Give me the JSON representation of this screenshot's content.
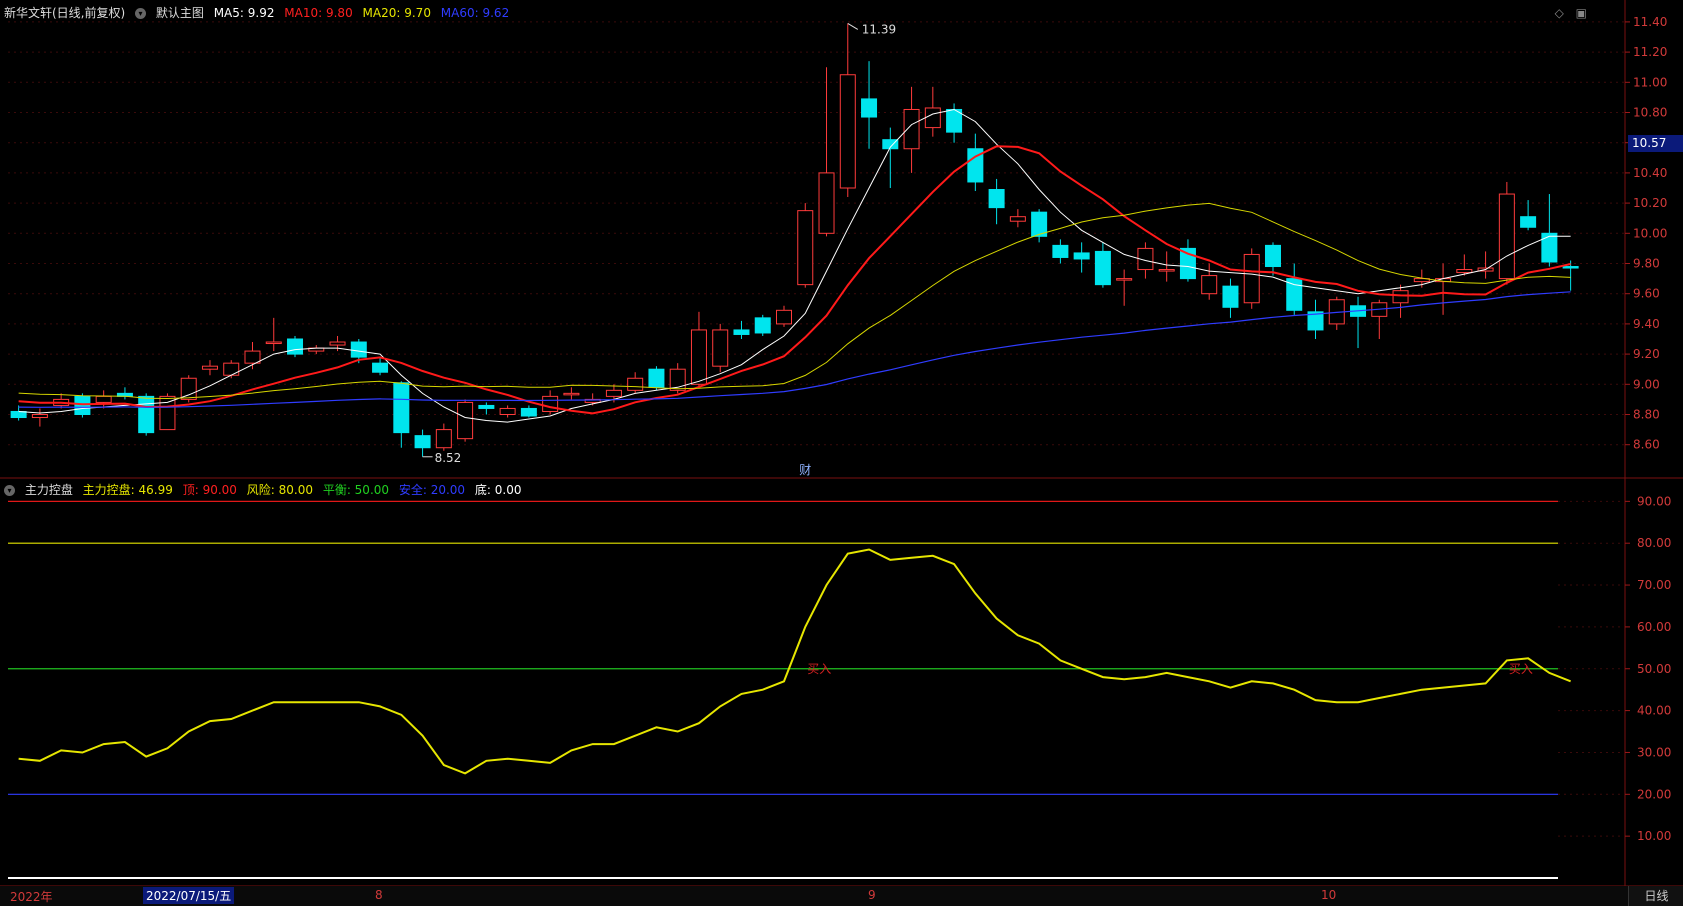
{
  "main_panel": {
    "title": "新华文轩(日线,前复权)",
    "template": "默认主图",
    "ma": [
      {
        "label": "MA5: 9.92",
        "color": "#ffffff"
      },
      {
        "label": "MA10: 9.80",
        "color": "#ff2020"
      },
      {
        "label": "MA20: 9.70",
        "color": "#e6e600"
      },
      {
        "label": "MA60: 9.62",
        "color": "#2f3cff"
      }
    ],
    "high_mark": "11.39",
    "low_mark": "8.52",
    "event_mark": "财",
    "current_price": "10.57",
    "yaxis": [
      "11.40",
      "11.20",
      "11.00",
      "10.80",
      "10.60",
      "10.40",
      "10.20",
      "10.00",
      "9.80",
      "9.60",
      "9.40",
      "9.20",
      "9.00",
      "8.80",
      "8.60"
    ]
  },
  "sub_panel": {
    "name": "主力控盘",
    "items": [
      {
        "label": "主力控盘: 46.99",
        "color": "#e6e600"
      },
      {
        "label": "顶: 90.00",
        "color": "#ff2020"
      },
      {
        "label": "风险: 80.00",
        "color": "#e6e600"
      },
      {
        "label": "平衡: 50.00",
        "color": "#20d020"
      },
      {
        "label": "安全: 20.00",
        "color": "#2f3cff"
      },
      {
        "label": "底: 0.00",
        "color": "#ffffff"
      }
    ],
    "signal_label": "买入",
    "yaxis": [
      "90.00",
      "80.00",
      "70.00",
      "60.00",
      "50.00",
      "40.00",
      "30.00",
      "20.00",
      "10.00"
    ]
  },
  "date_axis": {
    "labels": [
      "2022年",
      "8",
      "9",
      "10"
    ],
    "selected_date": "2022/07/15/五",
    "period": "日线"
  },
  "chart_data": [
    {
      "type": "candlestick",
      "title": "新华文轩(日线,前复权)",
      "ylim": [
        8.45,
        11.5
      ],
      "candles": [
        [
          8.82,
          8.78,
          8.86,
          8.76
        ],
        [
          8.78,
          8.8,
          8.84,
          8.72
        ],
        [
          8.86,
          8.9,
          8.94,
          8.84
        ],
        [
          8.92,
          8.8,
          8.94,
          8.78
        ],
        [
          8.88,
          8.92,
          8.96,
          8.84
        ],
        [
          8.94,
          8.92,
          8.98,
          8.9
        ],
        [
          8.92,
          8.68,
          8.94,
          8.66
        ],
        [
          8.7,
          8.92,
          8.94,
          8.7
        ],
        [
          8.9,
          9.04,
          9.06,
          8.88
        ],
        [
          9.1,
          9.12,
          9.16,
          9.06
        ],
        [
          9.06,
          9.14,
          9.16,
          9.04
        ],
        [
          9.14,
          9.22,
          9.28,
          9.1
        ],
        [
          9.28,
          9.28,
          9.44,
          9.22
        ],
        [
          9.3,
          9.2,
          9.32,
          9.18
        ],
        [
          9.22,
          9.24,
          9.26,
          9.2
        ],
        [
          9.26,
          9.28,
          9.32,
          9.22
        ],
        [
          9.28,
          9.18,
          9.3,
          9.14
        ],
        [
          9.14,
          9.08,
          9.18,
          9.06
        ],
        [
          9.01,
          8.68,
          9.02,
          8.58
        ],
        [
          8.66,
          8.58,
          8.7,
          8.52
        ],
        [
          8.58,
          8.7,
          8.74,
          8.56
        ],
        [
          8.64,
          8.88,
          8.9,
          8.62
        ],
        [
          8.86,
          8.84,
          8.88,
          8.8
        ],
        [
          8.8,
          8.84,
          8.86,
          8.78
        ],
        [
          8.84,
          8.79,
          8.86,
          8.78
        ],
        [
          8.82,
          8.92,
          8.96,
          8.8
        ],
        [
          8.94,
          8.94,
          8.98,
          8.9
        ],
        [
          8.88,
          8.9,
          8.94,
          8.86
        ],
        [
          8.92,
          8.96,
          9.0,
          8.88
        ],
        [
          8.96,
          9.04,
          9.08,
          8.94
        ],
        [
          9.1,
          8.98,
          9.12,
          8.96
        ],
        [
          8.96,
          9.1,
          9.14,
          8.94
        ],
        [
          9.0,
          9.36,
          9.48,
          8.98
        ],
        [
          9.12,
          9.36,
          9.4,
          9.08
        ],
        [
          9.36,
          9.33,
          9.42,
          9.3
        ],
        [
          9.44,
          9.34,
          9.46,
          9.32
        ],
        [
          9.4,
          9.49,
          9.52,
          9.38
        ],
        [
          9.66,
          10.15,
          10.2,
          9.64
        ],
        [
          10.0,
          10.4,
          11.1,
          9.98
        ],
        [
          10.3,
          11.05,
          11.39,
          10.24
        ],
        [
          10.89,
          10.77,
          11.14,
          10.56
        ],
        [
          10.62,
          10.56,
          10.7,
          10.3
        ],
        [
          10.56,
          10.82,
          10.97,
          10.4
        ],
        [
          10.7,
          10.83,
          10.97,
          10.64
        ],
        [
          10.82,
          10.67,
          10.86,
          10.6
        ],
        [
          10.56,
          10.34,
          10.66,
          10.28
        ],
        [
          10.29,
          10.17,
          10.36,
          10.06
        ],
        [
          10.08,
          10.11,
          10.16,
          10.04
        ],
        [
          10.14,
          9.98,
          10.16,
          9.94
        ],
        [
          9.92,
          9.84,
          9.96,
          9.8
        ],
        [
          9.87,
          9.83,
          9.94,
          9.74
        ],
        [
          9.88,
          9.66,
          9.94,
          9.64
        ],
        [
          9.7,
          9.7,
          9.76,
          9.52
        ],
        [
          9.76,
          9.9,
          9.94,
          9.7
        ],
        [
          9.76,
          9.76,
          9.88,
          9.68
        ],
        [
          9.9,
          9.7,
          9.96,
          9.68
        ],
        [
          9.6,
          9.72,
          9.8,
          9.56
        ],
        [
          9.65,
          9.51,
          9.7,
          9.44
        ],
        [
          9.54,
          9.86,
          9.9,
          9.5
        ],
        [
          9.92,
          9.78,
          9.94,
          9.72
        ],
        [
          9.7,
          9.49,
          9.8,
          9.46
        ],
        [
          9.48,
          9.36,
          9.56,
          9.3
        ],
        [
          9.4,
          9.56,
          9.58,
          9.36
        ],
        [
          9.52,
          9.45,
          9.58,
          9.24
        ],
        [
          9.45,
          9.54,
          9.56,
          9.3
        ],
        [
          9.54,
          9.62,
          9.66,
          9.44
        ],
        [
          9.68,
          9.7,
          9.76,
          9.64
        ],
        [
          9.68,
          9.7,
          9.8,
          9.46
        ],
        [
          9.74,
          9.76,
          9.86,
          9.72
        ],
        [
          9.75,
          9.77,
          9.88,
          9.7
        ],
        [
          9.7,
          10.26,
          10.34,
          9.66
        ],
        [
          10.11,
          10.04,
          10.22,
          10.02
        ],
        [
          10.0,
          9.81,
          10.26,
          9.78
        ],
        [
          9.78,
          9.77,
          9.82,
          9.62
        ]
      ],
      "ma_series": {
        "MA5": [
          8.82,
          8.81,
          8.82,
          8.84,
          8.85,
          8.86,
          8.87,
          8.88,
          8.93,
          8.99,
          9.06,
          9.13,
          9.2,
          9.23,
          9.24,
          9.24,
          9.22,
          9.2,
          9.06,
          8.94,
          8.85,
          8.78,
          8.76,
          8.75,
          8.77,
          8.79,
          8.84,
          8.87,
          8.9,
          8.94,
          8.96,
          8.98,
          9.02,
          9.07,
          9.13,
          9.23,
          9.32,
          9.47,
          9.75,
          10.03,
          10.3,
          10.57,
          10.72,
          10.79,
          10.82,
          10.74,
          10.59,
          10.46,
          10.29,
          10.14,
          10.02,
          9.94,
          9.86,
          9.82,
          9.79,
          9.78,
          9.75,
          9.74,
          9.73,
          9.71,
          9.66,
          9.64,
          9.62,
          9.6,
          9.62,
          9.64,
          9.66,
          9.7,
          9.73,
          9.76,
          9.85,
          9.92,
          9.98,
          9.98
        ]
      }
    },
    {
      "type": "line",
      "title": "主力控盘",
      "ylim": [
        0,
        100
      ],
      "series": [
        {
          "name": "主力控盘",
          "values": [
            28.5,
            28,
            30.5,
            30,
            32,
            32.5,
            29,
            31,
            35,
            37.5,
            38,
            40,
            42,
            42,
            42,
            42,
            42,
            41,
            39,
            34,
            27,
            25,
            28,
            28.5,
            28,
            27.5,
            30.5,
            32,
            32,
            34,
            36,
            35,
            37,
            41,
            44,
            45,
            47,
            60,
            70,
            77.5,
            78.5,
            76,
            76.5,
            77,
            75,
            68,
            62,
            58,
            56,
            52,
            50,
            48,
            47.5,
            48,
            49,
            48,
            47,
            45.5,
            47,
            46.5,
            45,
            42.5,
            42,
            42,
            43,
            44,
            45,
            45.5,
            46,
            46.5,
            52,
            52.5,
            49,
            46.99
          ]
        }
      ],
      "reference_lines": {
        "顶": 90,
        "风险": 80,
        "平衡": 50,
        "安全": 20,
        "底": 0
      }
    }
  ]
}
